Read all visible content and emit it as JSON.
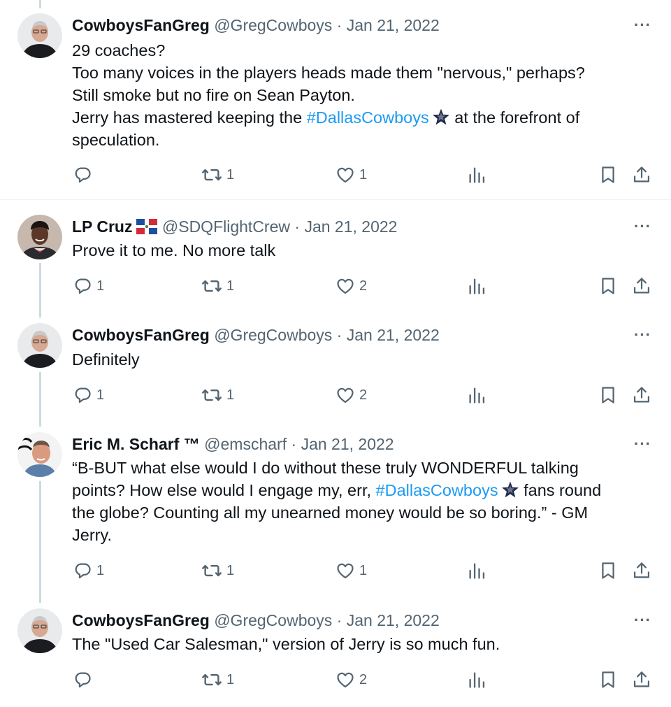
{
  "tweets": [
    {
      "name": "CowboysFanGreg",
      "handle": "@GregCowboys",
      "date": "Jan 21, 2022",
      "lines": [
        "29 coaches?",
        "Too many voices in the players heads made them \"nervous,\" perhaps?",
        "Still smoke but no fire on Sean Payton."
      ],
      "line4_pre": "Jerry has mastered keeping the ",
      "line4_hashtag": "#DallasCowboys",
      "line4_post": " at the forefront of",
      "line5": "speculation.",
      "replies": "",
      "retweets": "1",
      "likes": "1"
    },
    {
      "name": "LP Cruz",
      "handle": "@SDQFlightCrew",
      "date": "Jan 21, 2022",
      "text": "Prove it to me. No more talk",
      "replies": "1",
      "retweets": "1",
      "likes": "2"
    },
    {
      "name": "CowboysFanGreg",
      "handle": "@GregCowboys",
      "date": "Jan 21, 2022",
      "text": "Definitely",
      "replies": "1",
      "retweets": "1",
      "likes": "2"
    },
    {
      "name": "Eric M. Scharf ™",
      "handle": "@emscharf",
      "date": "Jan 21, 2022",
      "line1": "“B-BUT what else would I do without these truly WONDERFUL talking",
      "line2_pre": "points? How else would I engage my, err, ",
      "line2_hashtag": "#DallasCowboys",
      "line2_post": " fans round",
      "line3": "the globe? Counting all my unearned money would be so boring.” - GM",
      "line4": "Jerry.",
      "replies": "1",
      "retweets": "1",
      "likes": "1"
    },
    {
      "name": "CowboysFanGreg",
      "handle": "@GregCowboys",
      "date": "Jan 21, 2022",
      "text": "The \"Used Car Salesman,\" version of Jerry is so much fun.",
      "replies": "",
      "retweets": "1",
      "likes": "2"
    }
  ],
  "separator": " · ",
  "more_label": "···",
  "colors": {
    "link": "#1d9bf0",
    "muted": "#536471",
    "text": "#0f1419",
    "thread": "#cfd9de"
  }
}
